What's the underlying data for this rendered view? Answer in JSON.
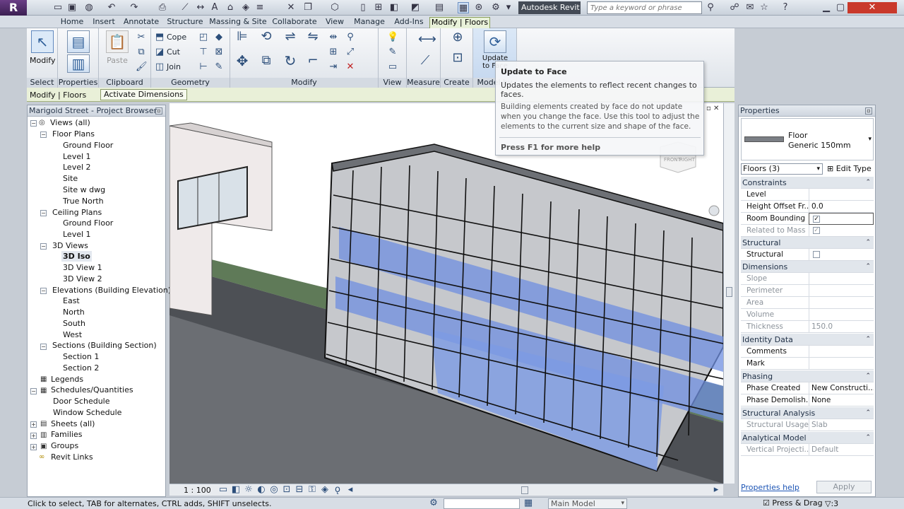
{
  "app": {
    "title": "Autodesk Revit ...",
    "search_placeholder": "Type a keyword or phrase",
    "logo_letter": "R"
  },
  "tabs": [
    {
      "label": "Home"
    },
    {
      "label": "Insert"
    },
    {
      "label": "Annotate"
    },
    {
      "label": "Structure"
    },
    {
      "label": "Massing & Site"
    },
    {
      "label": "Collaborate"
    },
    {
      "label": "View"
    },
    {
      "label": "Manage"
    },
    {
      "label": "Add-Ins"
    },
    {
      "label": "Modify | Floors"
    }
  ],
  "ribbon": {
    "select": {
      "label": "Select",
      "modify": "Modify"
    },
    "properties": {
      "label": "Properties",
      "button": "Properties"
    },
    "clipboard": {
      "label": "Clipboard",
      "paste": "Paste"
    },
    "geometry": {
      "label": "Geometry",
      "cope": "Cope",
      "cut": "Cut",
      "join": "Join"
    },
    "modify_panel": {
      "label": "Modify"
    },
    "view": {
      "label": "View"
    },
    "measure": {
      "label": "Measure"
    },
    "create": {
      "label": "Create"
    },
    "model_by_face": {
      "label": "Model by Face",
      "button": "Update to Face"
    }
  },
  "context_bar": {
    "label": "Modify | Floors",
    "activate_dimensions": "Activate Dimensions"
  },
  "tooltip": {
    "title": "Update to Face",
    "short": "Updates the elements to reflect recent changes to faces.",
    "long": "Building elements created by face do not update when you change the face. Use this tool to adjust the elements to the current size and shape of the face.",
    "help": "Press F1 for more help"
  },
  "project_browser": {
    "title": "Marigold Street - Project Browser",
    "items": [
      {
        "label": "Views (all)"
      },
      {
        "label": "Floor Plans"
      },
      {
        "label": "Ground Floor"
      },
      {
        "label": "Level 1"
      },
      {
        "label": "Level 2"
      },
      {
        "label": "Site"
      },
      {
        "label": "Site w dwg"
      },
      {
        "label": "True North"
      },
      {
        "label": "Ceiling Plans"
      },
      {
        "label": "Ground Floor"
      },
      {
        "label": "Level 1"
      },
      {
        "label": "3D Views"
      },
      {
        "label": "3D Iso"
      },
      {
        "label": "3D View 1"
      },
      {
        "label": "3D View 2"
      },
      {
        "label": "Elevations (Building Elevation)"
      },
      {
        "label": "East"
      },
      {
        "label": "North"
      },
      {
        "label": "South"
      },
      {
        "label": "West"
      },
      {
        "label": "Sections (Building Section)"
      },
      {
        "label": "Section 1"
      },
      {
        "label": "Section 2"
      },
      {
        "label": "Legends"
      },
      {
        "label": "Schedules/Quantities"
      },
      {
        "label": "Door Schedule"
      },
      {
        "label": "Window Schedule"
      },
      {
        "label": "Sheets (all)"
      },
      {
        "label": "Families"
      },
      {
        "label": "Groups"
      },
      {
        "label": "Revit Links"
      }
    ]
  },
  "viewport": {
    "scale": "1 : 100",
    "viewcube_front": "FRONT",
    "viewcube_right": "RIGHT"
  },
  "properties": {
    "title": "Properties",
    "type_name": "Floor",
    "type_sub": "Generic 150mm",
    "filter": "Floors (3)",
    "edit_type": "Edit Type",
    "help": "Properties help",
    "apply": "Apply",
    "rows": [
      {
        "cat": "Constraints"
      },
      {
        "name": "Level",
        "value": ""
      },
      {
        "name": "Height Offset Fr...",
        "value": "0.0"
      },
      {
        "name": "Room Bounding",
        "value": "✓"
      },
      {
        "name": "Related to Mass",
        "value": "✓"
      },
      {
        "cat": "Structural"
      },
      {
        "name": "Structural",
        "value": ""
      },
      {
        "cat": "Dimensions"
      },
      {
        "name": "Slope",
        "value": ""
      },
      {
        "name": "Perimeter",
        "value": ""
      },
      {
        "name": "Area",
        "value": ""
      },
      {
        "name": "Volume",
        "value": ""
      },
      {
        "name": "Thickness",
        "value": "150.0"
      },
      {
        "cat": "Identity Data"
      },
      {
        "name": "Comments",
        "value": ""
      },
      {
        "name": "Mark",
        "value": ""
      },
      {
        "cat": "Phasing"
      },
      {
        "name": "Phase Created",
        "value": "New Constructi..."
      },
      {
        "name": "Phase Demolish...",
        "value": "None"
      },
      {
        "cat": "Structural Analysis"
      },
      {
        "name": "Structural Usage",
        "value": "Slab"
      },
      {
        "cat": "Analytical Model"
      },
      {
        "name": "Vertical Projecti...",
        "value": "Default"
      }
    ]
  },
  "status": {
    "text": "Click to select, TAB for alternates, CTRL adds, SHIFT unselects.",
    "model": "Main Model",
    "press_drag": "Press & Drag",
    "filter_count": ":3"
  },
  "colors": {
    "accent": "#8aa05a",
    "brand": "#4b2a66",
    "glass": "#5a7fd6"
  }
}
